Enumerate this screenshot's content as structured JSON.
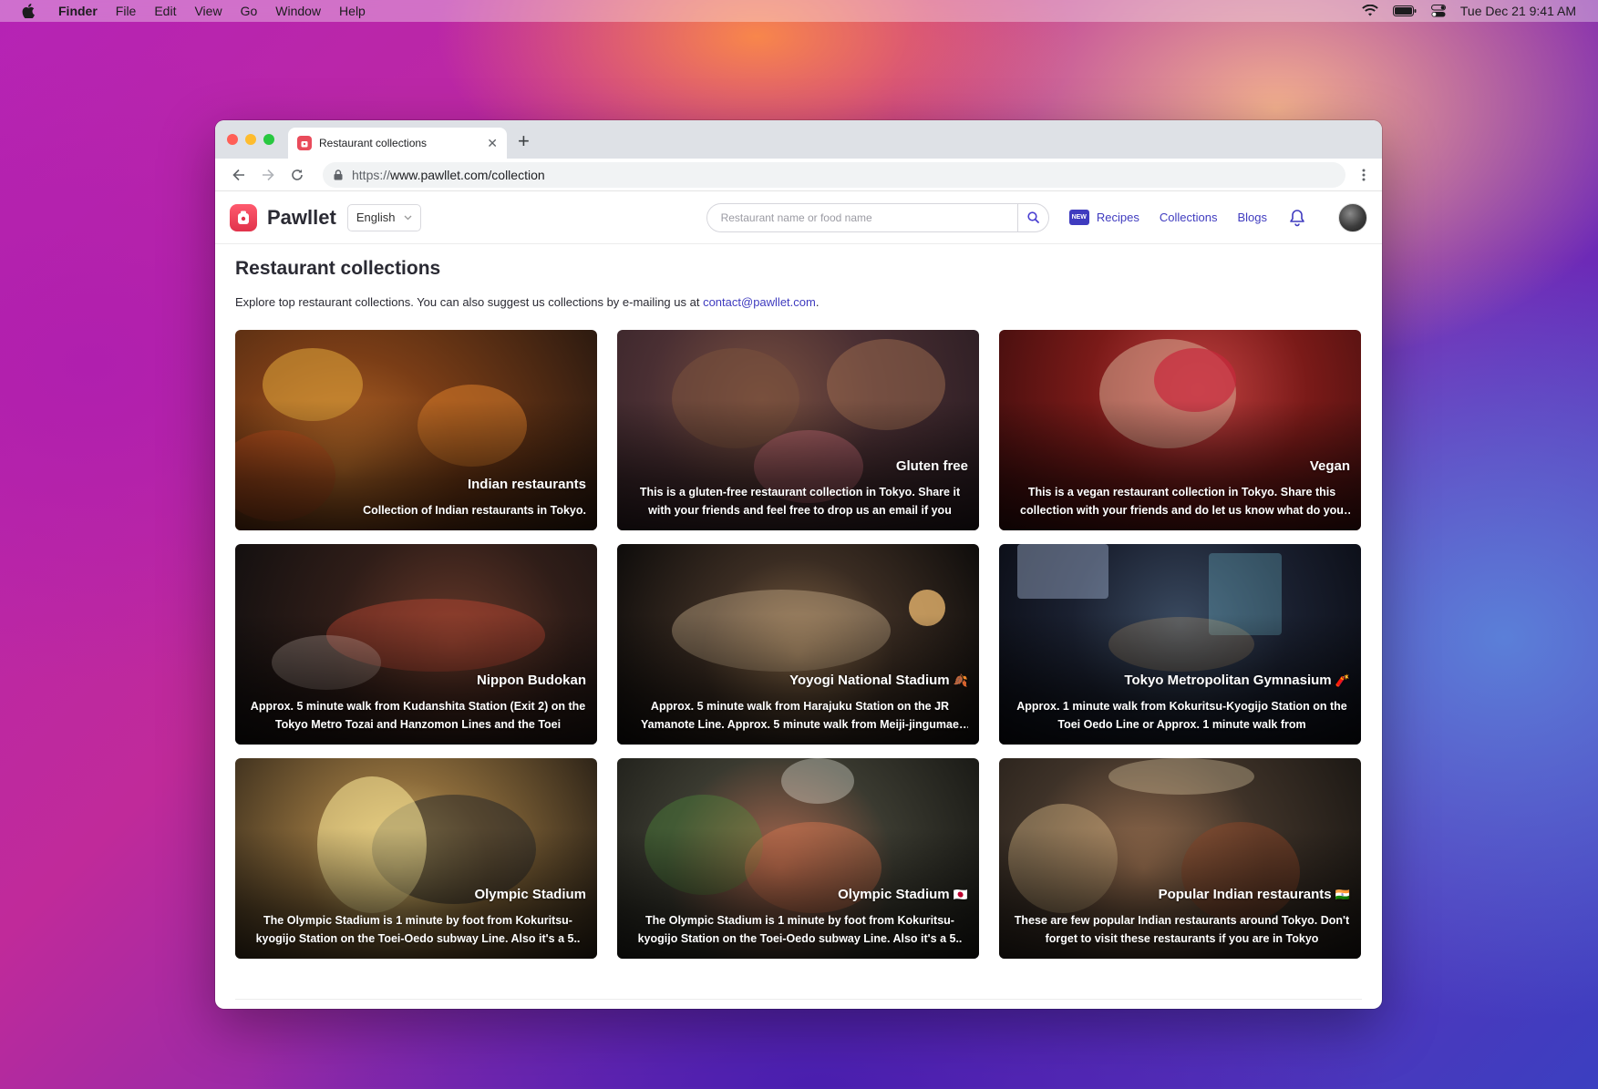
{
  "menubar": {
    "app": "Finder",
    "items": [
      "File",
      "Edit",
      "View",
      "Go",
      "Window",
      "Help"
    ],
    "clock": "Tue Dec 21  9:41 AM"
  },
  "browser": {
    "tab_title": "Restaurant collections",
    "url_scheme": "https://",
    "url_rest": "www.pawllet.com/collection"
  },
  "site": {
    "brand": "Pawllet",
    "language": "English",
    "search_placeholder": "Restaurant name or food name",
    "new_badge": "NEW",
    "nav": [
      "Recipes",
      "Collections",
      "Blogs"
    ]
  },
  "page": {
    "title": "Restaurant collections",
    "intro": "Explore top restaurant collections. You can also suggest us collections by e-mailing us at ",
    "email": "contact@pawllet.com",
    "intro_end": "."
  },
  "cards": [
    {
      "title": "Indian restaurants",
      "flag": "",
      "desc": "Collection of Indian restaurants in Tokyo."
    },
    {
      "title": "Gluten free",
      "flag": "",
      "desc": "This is a gluten-free restaurant collection in Tokyo. Share it with your friends and feel free to drop us an email if you"
    },
    {
      "title": "Vegan",
      "flag": "",
      "desc": "This is a vegan restaurant collection in Tokyo. Share this collection with your friends and do let us know what do you think"
    },
    {
      "title": "Nippon Budokan",
      "flag": "",
      "desc": "Approx. 5 minute walk from Kudanshita Station (Exit 2) on the Tokyo Metro Tozai and Hanzomon Lines and the Toei"
    },
    {
      "title": "Yoyogi National Stadium",
      "flag": "🍂",
      "desc": "Approx. 5 minute walk from Harajuku Station on the JR Yamanote Line. Approx. 5 minute walk from Meiji-jingumae Station"
    },
    {
      "title": "Tokyo Metropolitan Gymnasium",
      "flag": "🧨",
      "desc": "Approx. 1 minute walk from Kokuritsu-Kyogijo Station on the Toei Oedo Line or Approx. 1 minute walk from"
    },
    {
      "title": "Olympic Stadium",
      "flag": "",
      "desc": "The Olympic Stadium is 1 minute by foot from Kokuritsu-kyogijo Station on the Toei-Oedo subway Line. Also it's a 5.."
    },
    {
      "title": "Olympic Stadium",
      "flag": "🇯🇵",
      "desc": "The Olympic Stadium is 1 minute by foot from Kokuritsu-kyogijo Station on the Toei-Oedo subway Line. Also it's a 5.."
    },
    {
      "title": "Popular Indian restaurants",
      "flag": "🇮🇳",
      "desc": "These are few popular Indian restaurants around Tokyo. Don't forget to visit these restaurants if you are in Tokyo"
    }
  ],
  "colors": {
    "accent": "#3f3bbf",
    "brand": "#e1334b"
  }
}
